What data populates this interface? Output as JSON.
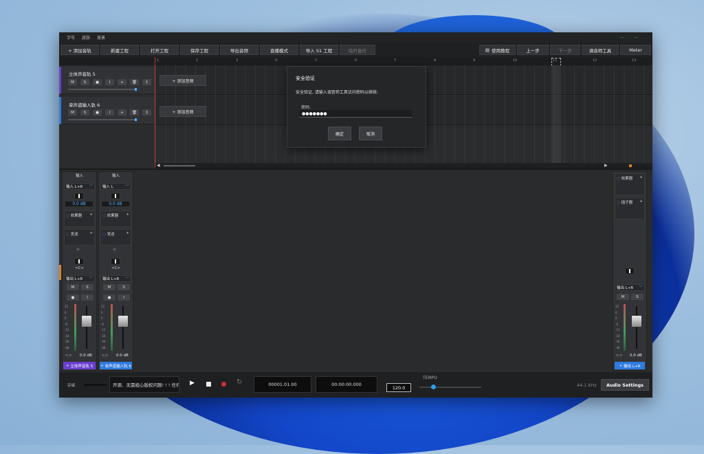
{
  "menu": [
    "字号",
    "皮肤",
    "背景"
  ],
  "toolbar": {
    "left": [
      "+ 添加音轨",
      "新建工程",
      "打开工程",
      "保存工程",
      "导出音频",
      "直播模式",
      "导入 S1 工程",
      "临时备份"
    ],
    "right": [
      "使用教程",
      "上一步",
      "下一步",
      "调音师工具",
      "Meter"
    ]
  },
  "ruler_ticks": [
    "1",
    "2",
    "3",
    "4",
    "5",
    "6",
    "7",
    "8",
    "9",
    "10",
    "11",
    "12",
    "13"
  ],
  "tracks": [
    {
      "name": "立体声音轨 5",
      "buttons": [
        "M",
        "S",
        "●",
        "I",
        "+",
        "🗑",
        "↕"
      ],
      "add_clip": "+ 添加音频",
      "color": "#6b3fd0"
    },
    {
      "name": "单声道输入轨 6",
      "buttons": [
        "M",
        "S",
        "●",
        "I",
        "+",
        "🗑",
        "↕"
      ],
      "add_clip": "+ 添加音频",
      "color": "#2f7be0"
    }
  ],
  "dialog": {
    "title": "安全验证",
    "message": "安全验证, 请输入调音师工具访问密码以继续:",
    "password_label": "密码:",
    "password_value": "●●●●●●●",
    "confirm": "确定",
    "cancel": "取消"
  },
  "mixer": {
    "channels": [
      {
        "header": "输入",
        "input": "输入 L+R",
        "gain": "0.0 dB",
        "fx": "效果器",
        "send": "发送",
        "pan": "<C>",
        "output": "输出 L+R",
        "mute": "M",
        "solo": "S",
        "rec": "●",
        "mon": "I",
        "level": "0.0 dB",
        "name": "立体声音轨 5",
        "color": "#6b3fd0"
      },
      {
        "header": "输入",
        "input": "输入 L",
        "gain": "0.0 dB",
        "fx": "效果器",
        "send": "发送",
        "pan": "<C>",
        "output": "输出 L+R",
        "mute": "M",
        "solo": "S",
        "rec": "●",
        "mon": "I",
        "level": "0.0 dB",
        "name": "单声道输入轨 6",
        "color": "#2f7be0"
      }
    ],
    "master": {
      "fx": "效果器",
      "plugin": "插子器",
      "output": "输出 L+R",
      "mute": "M",
      "solo": "S",
      "level": "0.0 dB",
      "name": "输出 L+R",
      "color": "#2f7be0"
    },
    "meter_scale": [
      "12",
      "6",
      "0",
      "-6",
      "-12",
      "-24",
      "-36",
      "-48"
    ]
  },
  "transport": {
    "status_label": "存储",
    "ticker": "开源、无需担心版权问题! ! ! 任何",
    "bars": "00001.01.00",
    "time": "00:00:00.000",
    "tempo_label": "TEMPO",
    "tempo": "120.0",
    "sample_rate": "44.1 kHz",
    "audio_settings": "Audio Settings"
  }
}
